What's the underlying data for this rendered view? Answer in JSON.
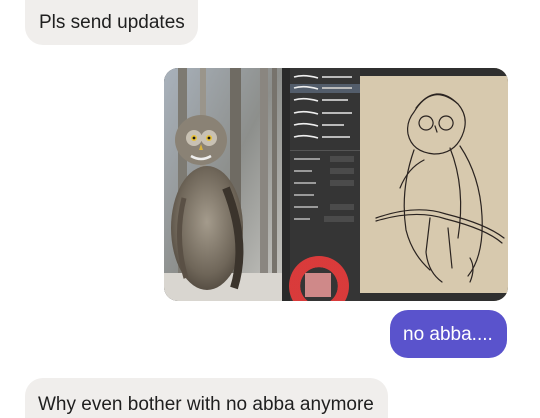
{
  "conversation": {
    "messages": [
      {
        "direction": "incoming",
        "type": "text",
        "text": "Pls send updates"
      },
      {
        "direction": "outgoing",
        "type": "image",
        "content": "screenshot-drawing-app-owl-reference-and-sketch"
      },
      {
        "direction": "outgoing",
        "type": "text",
        "text": "no abba...."
      },
      {
        "direction": "incoming",
        "type": "text",
        "text": "Why even bother with no abba anymore"
      }
    ]
  },
  "colors": {
    "incoming_bubble": "#f0eeec",
    "outgoing_bubble": "#5a53cc",
    "canvas": "#d7c9ae",
    "app_panel": "#353535"
  }
}
